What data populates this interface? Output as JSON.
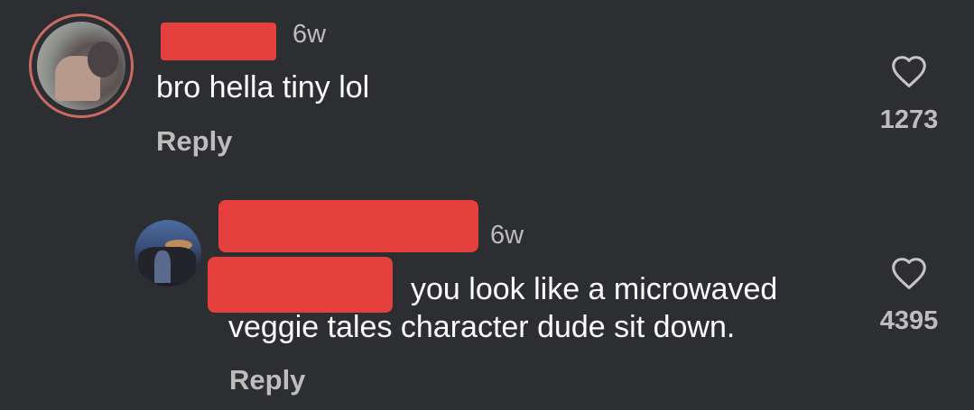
{
  "comments": [
    {
      "timestamp": "6w",
      "text": "bro hella tiny lol",
      "reply_label": "Reply",
      "like_icon": "heart-outline-icon",
      "likes": "1273"
    },
    {
      "timestamp": "6w",
      "text_line1": "you look like a microwaved",
      "text_line2": "veggie tales character dude sit down.",
      "reply_label": "Reply",
      "like_icon": "heart-outline-icon",
      "likes": "4395"
    }
  ],
  "colors": {
    "background": "#2d2e32",
    "redaction": "#e5403d",
    "avatar_ring": "#c96a63",
    "secondary_text": "#bdbdbd"
  }
}
